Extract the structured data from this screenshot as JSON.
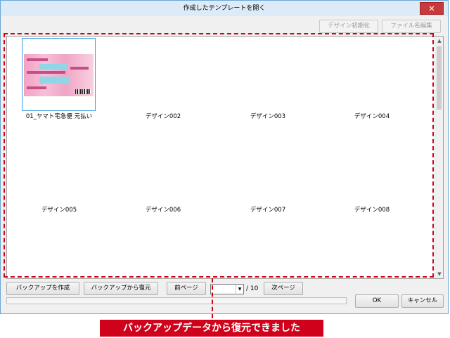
{
  "window": {
    "title": "作成したテンプレートを開く",
    "close_label": "✕"
  },
  "toolbar": {
    "reset_label": "デザイン初期化",
    "rename_label": "ファイル名編集"
  },
  "designs": [
    {
      "label": "01_ヤマト宅急便 元払い"
    },
    {
      "label": "デザイン002"
    },
    {
      "label": "デザイン003"
    },
    {
      "label": "デザイン004"
    },
    {
      "label": "デザイン005"
    },
    {
      "label": "デザイン006"
    },
    {
      "label": "デザイン007"
    },
    {
      "label": "デザイン008"
    }
  ],
  "footer": {
    "backup_create_label": "バックアップを作成",
    "backup_restore_label": "バックアップから復元",
    "prev_page_label": "前ページ",
    "page_total": "/ 10",
    "next_page_label": "次ページ",
    "ok_label": "OK",
    "cancel_label": "キャンセル"
  },
  "annotation": {
    "message": "バックアップデータから復元できました",
    "color": "#d0021b"
  },
  "colors": {
    "titlebar": "#dcebf7",
    "close_button": "#c7393c",
    "selection_border": "#3c9fe6"
  },
  "icons": {
    "scroll_up": "▲",
    "scroll_down": "▼",
    "dropdown": "▼"
  }
}
